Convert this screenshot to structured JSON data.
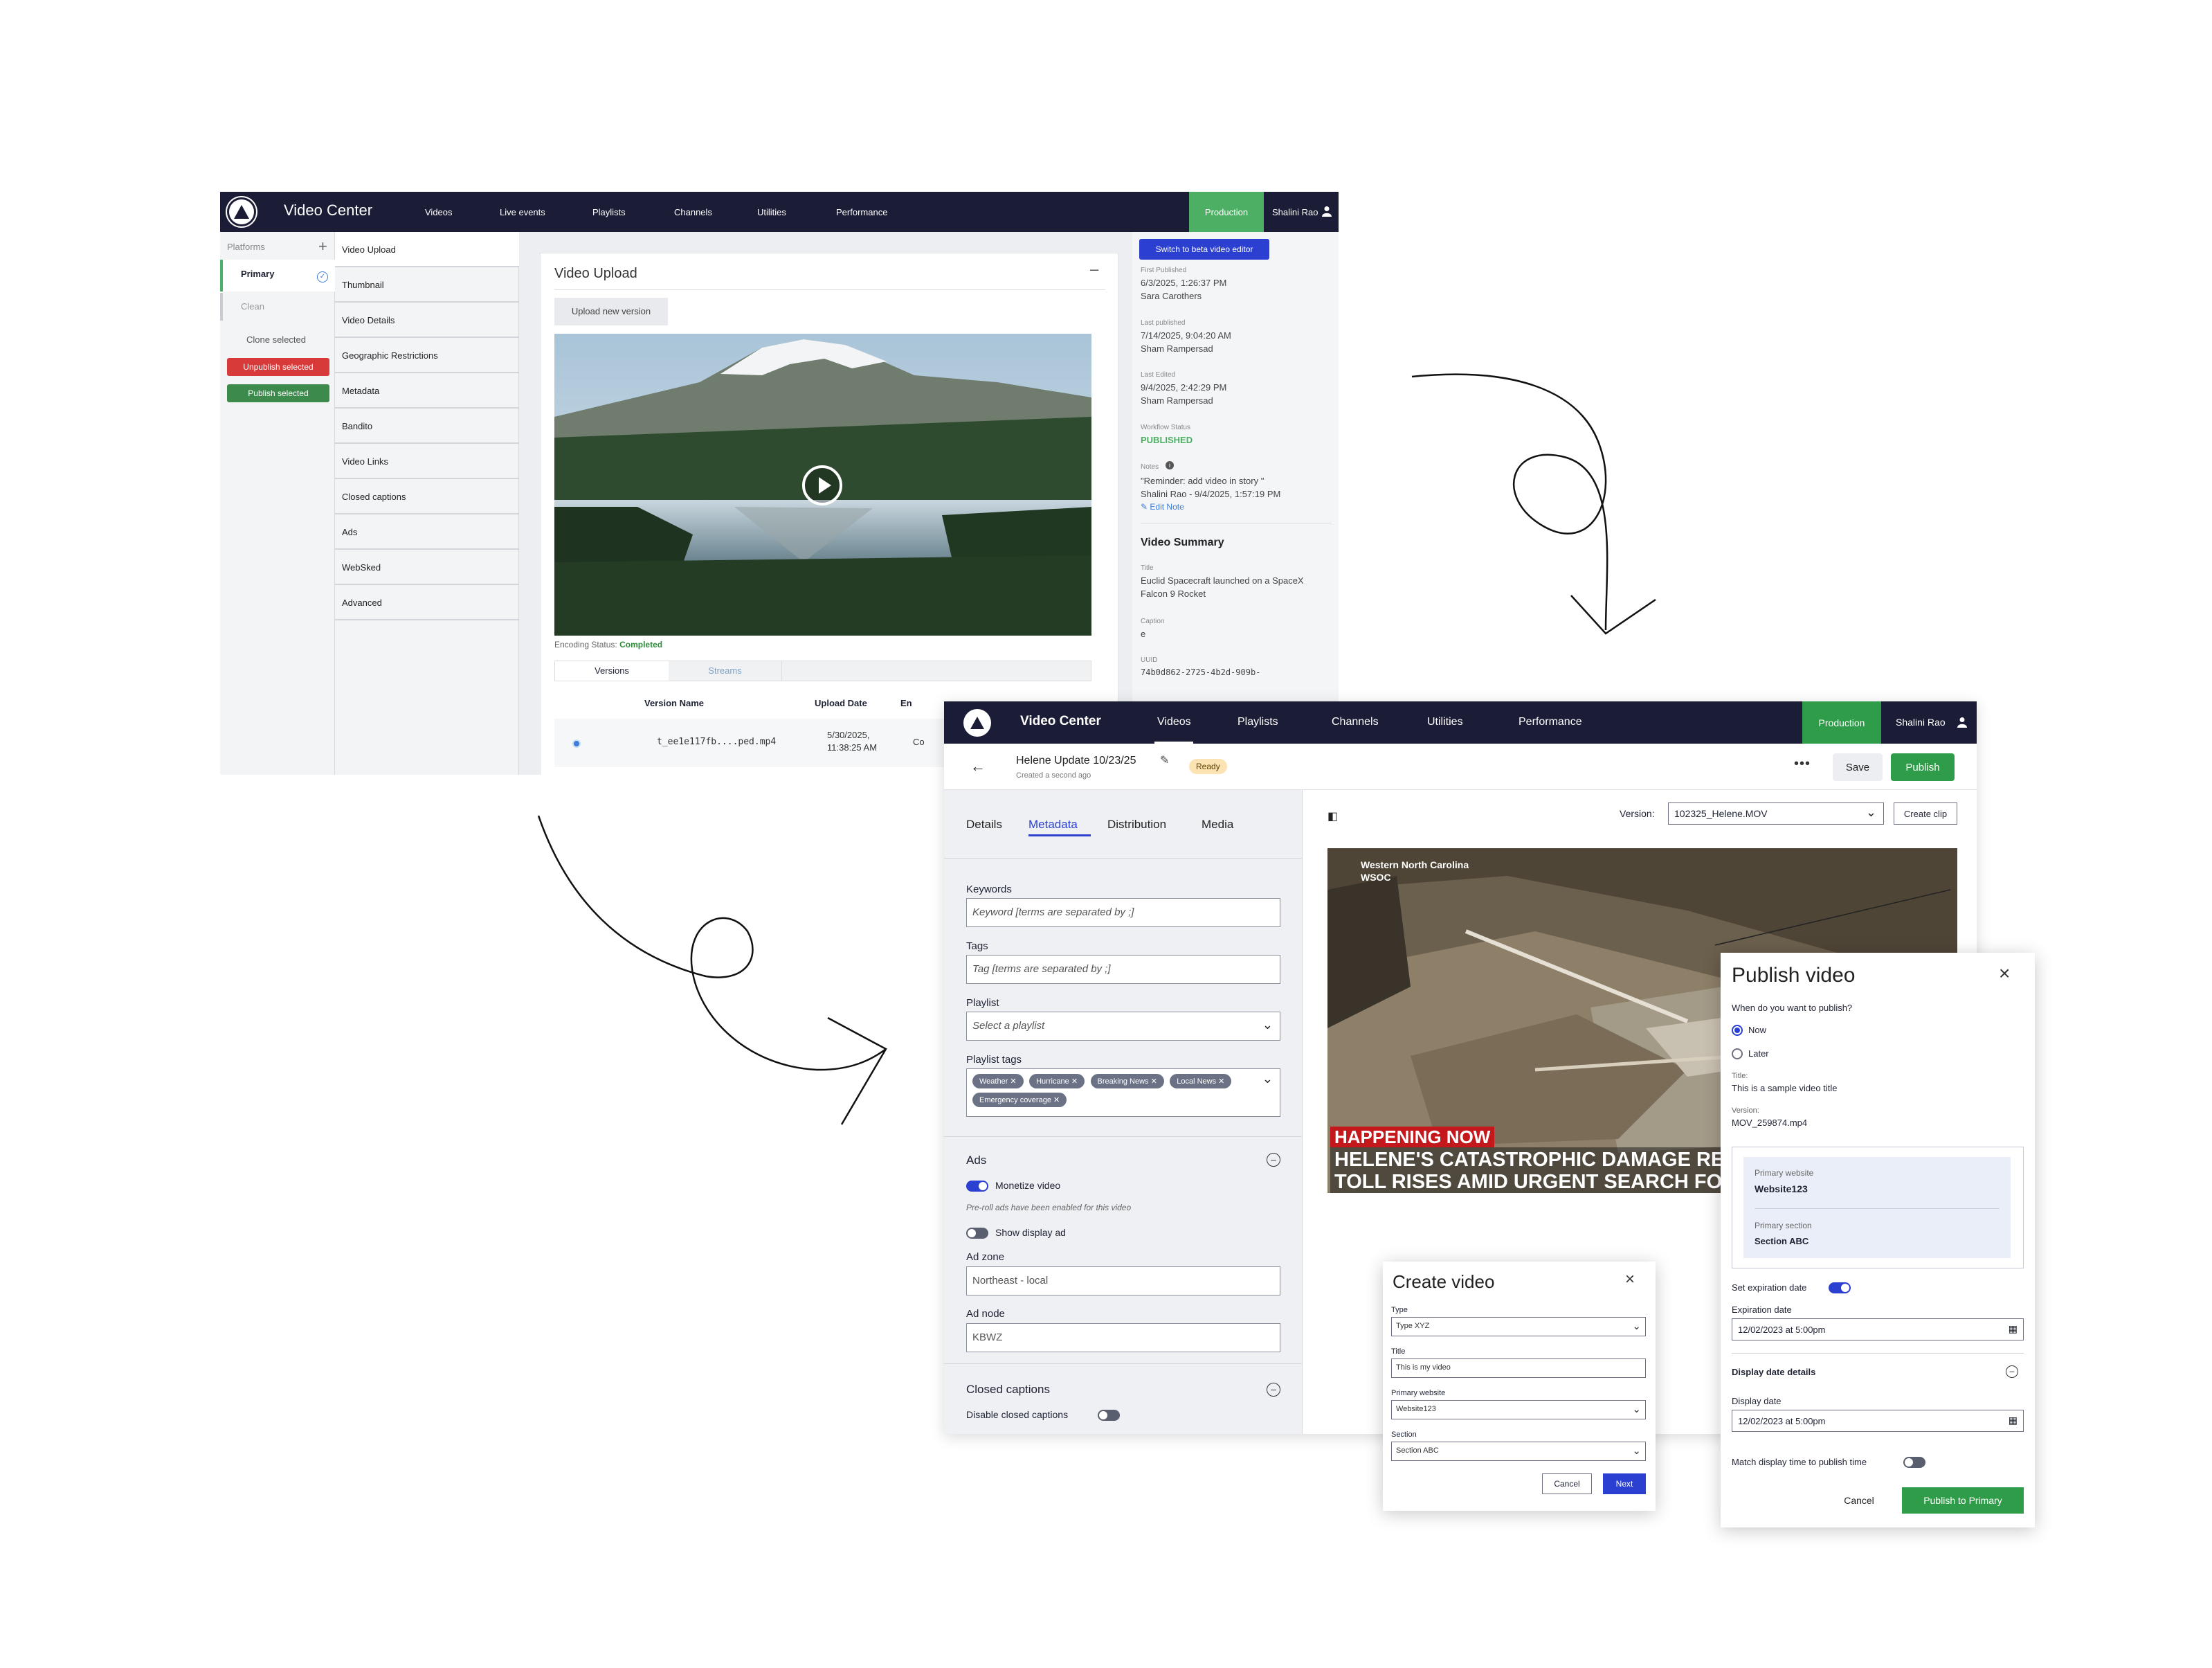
{
  "old_window": {
    "brand": "Video Center",
    "nav": [
      "Videos",
      "Live events",
      "Playlists",
      "Channels",
      "Utilities",
      "Performance"
    ],
    "environment": "Production",
    "user": "Shalini Rao",
    "platforms_label": "Platforms",
    "platforms": [
      "Primary",
      "Clean"
    ],
    "actions": {
      "clone": "Clone selected",
      "unpublish": "Unpublish selected",
      "publish": "Publish selected"
    },
    "sections": [
      "Video Upload",
      "Thumbnail",
      "Video Details",
      "Geographic Restrictions",
      "Metadata",
      "Bandito",
      "Video Links",
      "Closed captions",
      "Ads",
      "WebSked",
      "Advanced"
    ],
    "panel_title": "Video Upload",
    "upload_button": "Upload new version",
    "encoding_label": "Encoding Status:",
    "encoding_value": "Completed",
    "tabs": [
      "Versions",
      "Streams"
    ],
    "table_headers": [
      "Version Name",
      "Upload Date",
      "En"
    ],
    "table_row": {
      "name": "t_ee1e117fb....ped.mp4",
      "date": "5/30/2025,",
      "time": "11:38:25 AM",
      "enc": "Co"
    },
    "beta_button": "Switch to beta video editor",
    "first_published_label": "First Published",
    "first_published": "6/3/2025, 1:26:37 PM",
    "first_published_by": "Sara Carothers",
    "last_published_label": "Last published",
    "last_published": "7/14/2025, 9:04:20 AM",
    "last_published_by": "Sham Rampersad",
    "last_edited_label": "Last Edited",
    "last_edited": "9/4/2025, 2:42:29 PM",
    "last_edited_by": "Sham Rampersad",
    "workflow_label": "Workflow Status",
    "workflow": "PUBLISHED",
    "notes_label": "Notes",
    "note": "\"Reminder: add video in story \"",
    "note_by": "Shalini Rao - 9/4/2025, 1:57:19 PM",
    "edit_note": "Edit Note",
    "summary_title": "Video Summary",
    "title_label": "Title",
    "title_line1": "Euclid Spacecraft launched on a SpaceX",
    "title_line2": "Falcon 9 Rocket",
    "caption_label": "Caption",
    "caption": "e",
    "uuid_label": "UUID",
    "uuid": "74b0d862-2725-4b2d-909b-"
  },
  "new_window": {
    "brand": "Video Center",
    "nav": [
      "Videos",
      "Playlists",
      "Channels",
      "Utilities",
      "Performance"
    ],
    "environment": "Production",
    "user": "Shalini Rao",
    "video_title": "Helene Update 10/23/25",
    "created": "Created a second ago",
    "status": "Ready",
    "save": "Save",
    "publish": "Publish",
    "tabs": [
      "Details",
      "Metadata",
      "Distribution",
      "Media"
    ],
    "keywords_label": "Keywords",
    "keywords_placeholder": "Keyword [terms are separated by ;]",
    "tags_label": "Tags",
    "tags_placeholder": "Tag [terms are separated by ;]",
    "playlist_label": "Playlist",
    "playlist_placeholder": "Select a playlist",
    "playlist_tags_label": "Playlist tags",
    "playlist_tags": [
      "Weather",
      "Hurricane",
      "Breaking News",
      "Local News",
      "Emergency coverage"
    ],
    "ads_title": "Ads",
    "monetize": "Monetize video",
    "monetize_note": "Pre-roll ads have been enabled for this video",
    "display_ad": "Show display ad",
    "ad_zone_label": "Ad zone",
    "ad_zone": "Northeast - local",
    "ad_node_label": "Ad node",
    "ad_node": "KBWZ",
    "cc_title": "Closed captions",
    "cc_disable": "Disable closed captions",
    "version_label": "Version:",
    "version": "102325_Helene.MOV",
    "create_clip": "Create clip",
    "video_overlay_line1": "Western North Carolina",
    "video_overlay_line2": "WSOC",
    "banner": "HAPPENING NOW",
    "headline1": "HELENE'S CATASTROPHIC DAMAGE REV",
    "headline2": "TOLL RISES AMID URGENT SEARCH FOR"
  },
  "create_dialog": {
    "title": "Create video",
    "type_label": "Type",
    "type": "Type XYZ",
    "title_label": "Title",
    "title_value": "This is my video",
    "website_label": "Primary website",
    "website": "Website123",
    "section_label": "Section",
    "section": "Section ABC",
    "cancel": "Cancel",
    "next": "Next"
  },
  "publish_dialog": {
    "title": "Publish video",
    "question": "When do you want to publish?",
    "now": "Now",
    "later": "Later",
    "title_label": "Title:",
    "title_value": "This is a sample video title",
    "version_label": "Version:",
    "version": "MOV_259874.mp4",
    "website_label": "Primary website",
    "website": "Website123",
    "section_label": "Primary section",
    "section": "Section ABC",
    "expiration_toggle": "Set expiration date",
    "expiration_label": "Expiration date",
    "expiration": "12/02/2023 at 5:00pm",
    "display_details": "Display date details",
    "display_label": "Display date",
    "display": "12/02/2023 at 5:00pm",
    "match": "Match display time to publish time",
    "cancel": "Cancel",
    "submit": "Publish to Primary"
  }
}
